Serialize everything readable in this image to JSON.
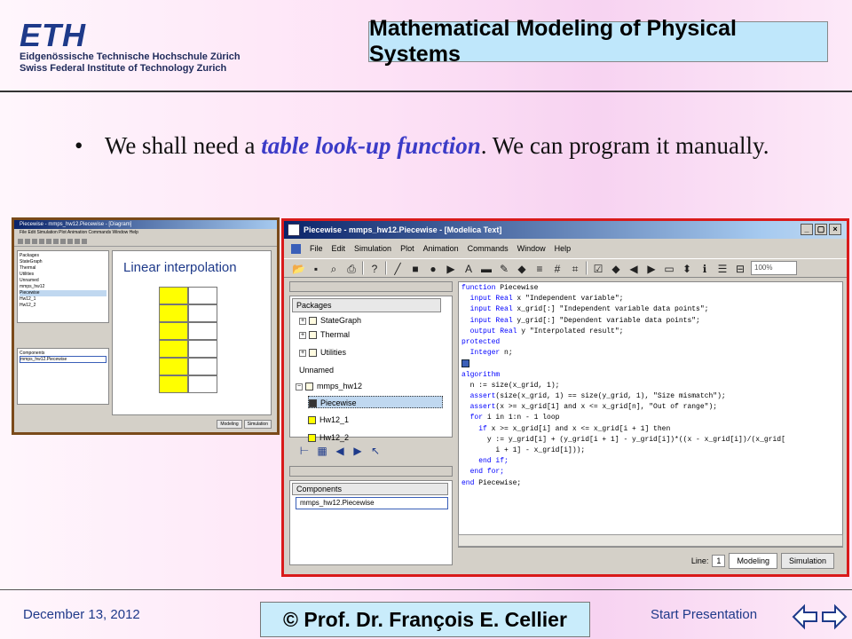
{
  "header": {
    "logo_mark": "ETH",
    "logo_line1": "Eidgenössische Technische Hochschule Zürich",
    "logo_line2": "Swiss Federal Institute of Technology Zurich",
    "title": "Mathematical Modeling of Physical Systems"
  },
  "slide": {
    "bullet_before": "We shall need a ",
    "bullet_emphasis": "table look-up function",
    "bullet_after": ".  We can program it manually."
  },
  "footer": {
    "date": "December 13, 2012",
    "start_presentation": "Start Presentation",
    "author": "© Prof. Dr. François E. Cellier",
    "nav_back_icon": "back-arrow-icon",
    "nav_forward_icon": "forward-arrow-icon"
  },
  "small_screenshot": {
    "title": "Piecewise - mmps_hw12.Piecewise - [Diagram]",
    "menu": "File  Edit  Simulation  Plot  Animation  Commands  Window  Help",
    "packages": [
      "Packages",
      "StateGraph",
      "Thermal",
      "Utilities",
      "Unnamed",
      "mmps_hw12",
      "Piecewise",
      "Hw12_1",
      "Hw12_2"
    ],
    "components_title": "Components",
    "component_item": "mmps_hw12.Piecewise",
    "canvas_label": "Linear interpolation",
    "tabs": [
      "Modeling",
      "Simulation"
    ]
  },
  "dymola": {
    "window_title": "Piecewise - mmps_hw12.Piecewise - [Modelica Text]",
    "window_buttons": [
      "_",
      "▢",
      "×"
    ],
    "menu": [
      "File",
      "Edit",
      "Simulation",
      "Plot",
      "Animation",
      "Commands",
      "Window",
      "Help"
    ],
    "zoom": "100%",
    "packages_title": "Packages",
    "tree": [
      {
        "label": "StateGraph",
        "icon": "package-icon"
      },
      {
        "label": "Thermal",
        "icon": "package-icon"
      },
      {
        "label": "Utilities",
        "icon": "package-icon"
      },
      {
        "label": "Unnamed",
        "icon": ""
      },
      {
        "label": "mmps_hw12",
        "icon": "package-icon"
      },
      {
        "label": "Piecewise",
        "icon": "function-icon"
      },
      {
        "label": "Hw12_1",
        "icon": "model-icon"
      },
      {
        "label": "Hw12_2",
        "icon": "model-icon"
      }
    ],
    "components_title": "Components",
    "component_item": "mmps_hw12.Piecewise",
    "code": [
      {
        "kw": "function",
        "rest": " Piecewise",
        "indent": 0
      },
      {
        "kw": "input Real",
        "rest": " x \"Independent variable\";",
        "indent": 2
      },
      {
        "kw": "input Real",
        "rest": " x_grid[:] \"Independent variable data points\";",
        "indent": 2
      },
      {
        "kw": "input Real",
        "rest": " y_grid[:] \"Dependent variable data points\";",
        "indent": 2
      },
      {
        "kw": "output Real",
        "rest": " y \"Interpolated result\";",
        "indent": 2
      },
      {
        "kw": "protected",
        "rest": "",
        "indent": 0
      },
      {
        "kw": "Integer",
        "rest": " n;",
        "indent": 2
      },
      {
        "kw": "",
        "rest": "",
        "indent": 0,
        "icon": true
      },
      {
        "kw": "algorithm",
        "rest": "",
        "indent": 0
      },
      {
        "kw": "",
        "rest": "n := size(x_grid, 1);",
        "indent": 2
      },
      {
        "kw": "assert",
        "rest": "(size(x_grid, 1) == size(y_grid, 1), \"Size mismatch\");",
        "indent": 2
      },
      {
        "kw": "assert",
        "rest": "(x >= x_grid[1] and x <= x_grid[n], \"Out of range\");",
        "indent": 2
      },
      {
        "kw": "for",
        "rest": " i in 1:n - 1 loop",
        "indent": 2
      },
      {
        "kw": "if",
        "rest": " x >= x_grid[i] and x <= x_grid[i + 1] then",
        "indent": 4
      },
      {
        "kw": "",
        "rest": "y := y_grid[i] + (y_grid[i + 1] - y_grid[i])*((x - x_grid[i])/(x_grid[",
        "indent": 6
      },
      {
        "kw": "",
        "rest": "i + 1] - x_grid[i]));",
        "indent": 8
      },
      {
        "kw": "end if;",
        "rest": "",
        "indent": 4
      },
      {
        "kw": "end for;",
        "rest": "",
        "indent": 2
      },
      {
        "kw": "end",
        "rest": " Piecewise;",
        "indent": 0
      }
    ],
    "status_line_label": "Line:",
    "status_line_value": "1",
    "tab_modeling": "Modeling",
    "tab_simulation": "Simulation"
  },
  "colors": {
    "title_box_bg": "#bfe7fb",
    "emphasis": "#3b3bc7",
    "keyword": "#0000ff",
    "big_shot_border": "#d91a1a"
  }
}
